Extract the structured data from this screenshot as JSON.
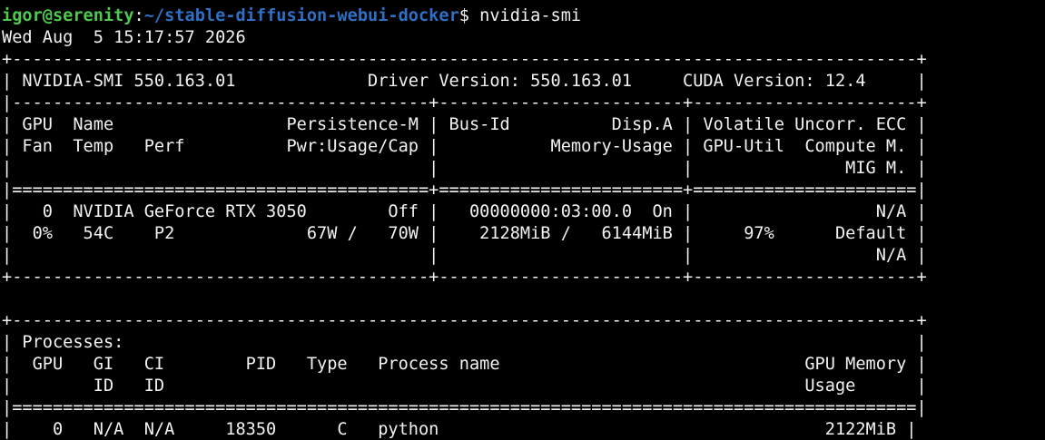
{
  "prompt": {
    "user_host": "igor@serenity",
    "separator": ":",
    "cwd": "~/stable-diffusion-webui-docker",
    "symbol": "$ ",
    "command": "nvidia-smi"
  },
  "output_lines": [
    "Wed Aug  5 15:17:57 2026",
    "+-----------------------------------------------------------------------------------------+",
    "| NVIDIA-SMI 550.163.01             Driver Version: 550.163.01     CUDA Version: 12.4     |",
    "|-----------------------------------------+------------------------+----------------------+",
    "| GPU  Name                 Persistence-M | Bus-Id          Disp.A | Volatile Uncorr. ECC |",
    "| Fan  Temp   Perf          Pwr:Usage/Cap |           Memory-Usage | GPU-Util  Compute M. |",
    "|                                         |                        |               MIG M. |",
    "|=========================================+========================+======================|",
    "|   0  NVIDIA GeForce RTX 3050        Off |   00000000:03:00.0  On |                  N/A |",
    "|  0%   54C    P2             67W /   70W |    2128MiB /   6144MiB |     97%      Default |",
    "|                                         |                        |                  N/A |",
    "+-----------------------------------------+------------------------+----------------------+",
    "",
    "+-----------------------------------------------------------------------------------------+",
    "| Processes:                                                                              |",
    "|  GPU   GI   CI        PID   Type   Process name                              GPU Memory |",
    "|        ID   ID                                                               Usage      |",
    "|=========================================================================================|",
    "|    0   N/A  N/A     18350      C   python                                      2122MiB |"
  ]
}
